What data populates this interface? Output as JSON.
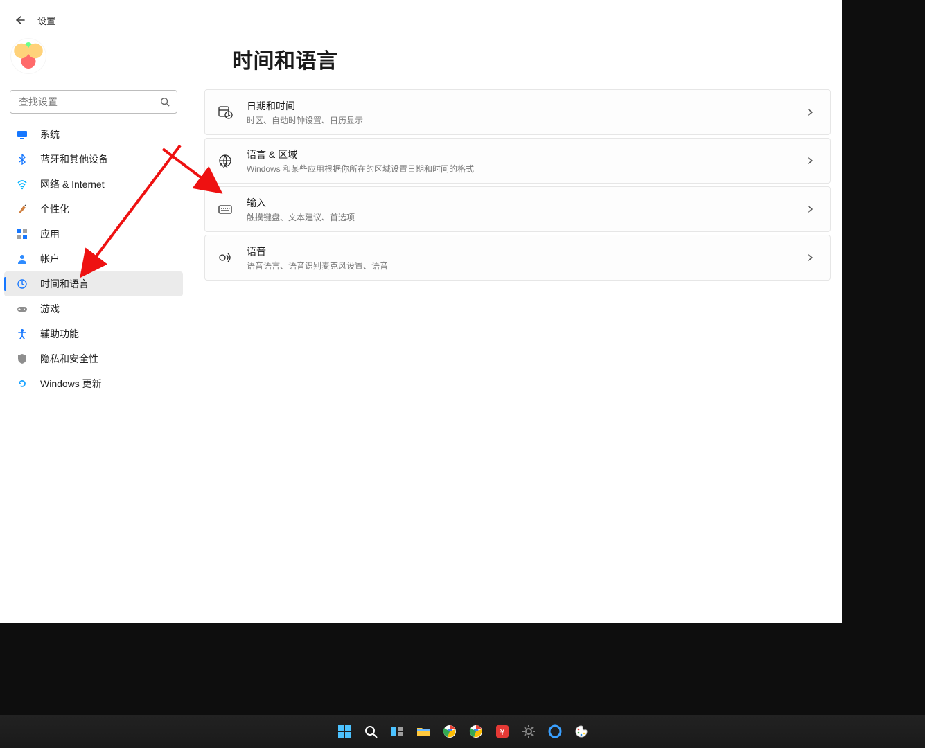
{
  "header": {
    "title": "设置"
  },
  "search": {
    "placeholder": "查找设置"
  },
  "sidebar": {
    "items": [
      {
        "label": "系统",
        "icon": "monitor",
        "color": "#1677ff"
      },
      {
        "label": "蓝牙和其他设备",
        "icon": "bluetooth",
        "color": "#1677ff"
      },
      {
        "label": "网络 & Internet",
        "icon": "wifi",
        "color": "#00b3ff"
      },
      {
        "label": "个性化",
        "icon": "brush",
        "color": "#b36b2c"
      },
      {
        "label": "应用",
        "icon": "apps",
        "color": "#1677ff"
      },
      {
        "label": "帐户",
        "icon": "user",
        "color": "#2e8bff"
      },
      {
        "label": "时间和语言",
        "icon": "globe-clock",
        "color": "#1677ff",
        "selected": true
      },
      {
        "label": "游戏",
        "icon": "gamepad",
        "color": "#8e8e8e"
      },
      {
        "label": "辅助功能",
        "icon": "accessibility",
        "color": "#1677ff"
      },
      {
        "label": "隐私和安全性",
        "icon": "shield",
        "color": "#8e8e8e"
      },
      {
        "label": "Windows 更新",
        "icon": "update",
        "color": "#1aa3ff"
      }
    ]
  },
  "main": {
    "title": "时间和语言",
    "cards": [
      {
        "title": "日期和时间",
        "desc": "时区、自动时钟设置、日历显示",
        "icon": "calendar-clock"
      },
      {
        "title": "语言 & 区域",
        "desc": "Windows 和某些应用根据你所在的区域设置日期和时间的格式",
        "icon": "globe-lang"
      },
      {
        "title": "输入",
        "desc": "触摸键盘、文本建议、首选项",
        "icon": "keyboard"
      },
      {
        "title": "语音",
        "desc": "语音语言、语音识别麦克风设置、语音",
        "icon": "voice"
      }
    ]
  },
  "taskbar": {
    "items": [
      {
        "name": "start",
        "icon": "start"
      },
      {
        "name": "search",
        "icon": "search"
      },
      {
        "name": "taskview",
        "icon": "taskview"
      },
      {
        "name": "explorer",
        "icon": "explorer"
      },
      {
        "name": "chrome",
        "icon": "chrome"
      },
      {
        "name": "chrome2",
        "icon": "chrome"
      },
      {
        "name": "yuan",
        "icon": "yuan"
      },
      {
        "name": "settings",
        "icon": "gear"
      },
      {
        "name": "cortana",
        "icon": "cortana"
      },
      {
        "name": "paint",
        "icon": "paint"
      }
    ]
  }
}
